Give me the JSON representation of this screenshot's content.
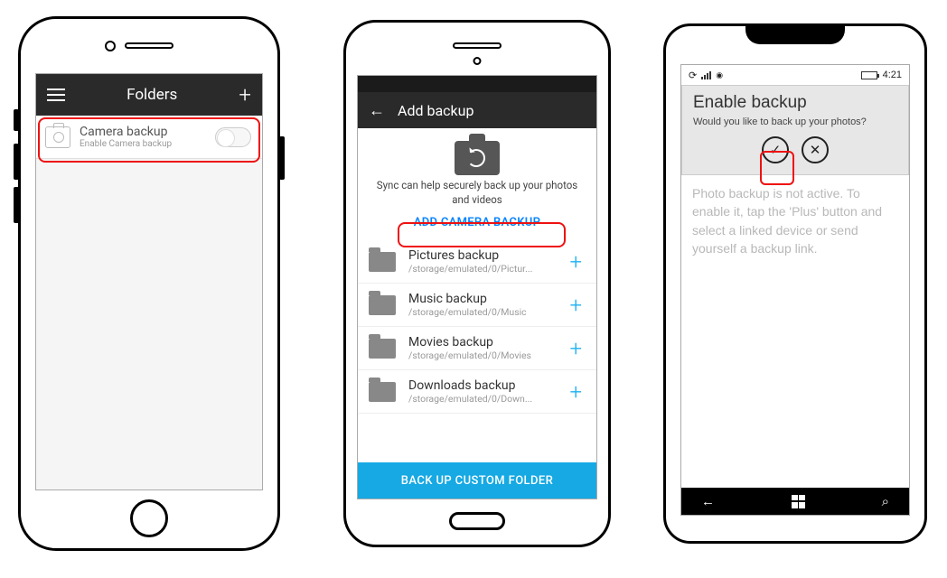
{
  "ios": {
    "header": {
      "title": "Folders"
    },
    "row": {
      "title": "Camera backup",
      "subtitle": "Enable Camera backup"
    }
  },
  "android": {
    "header": {
      "title": "Add backup"
    },
    "hero": {
      "text": "Sync can help securely back up your photos and videos",
      "cta": "ADD CAMERA BACKUP"
    },
    "items": [
      {
        "title": "Pictures backup",
        "path": "/storage/emulated/0/Pictur..."
      },
      {
        "title": "Music backup",
        "path": "/storage/emulated/0/Music"
      },
      {
        "title": "Movies backup",
        "path": "/storage/emulated/0/Movies"
      },
      {
        "title": "Downloads backup",
        "path": "/storage/emulated/0/Down..."
      }
    ],
    "footer": "BACK UP CUSTOM FOLDER"
  },
  "wp": {
    "status": {
      "time": "4:21"
    },
    "dialog": {
      "title": "Enable backup",
      "message": "Would you like to back up your photos?"
    },
    "body": "Photo backup is not active. To enable it, tap the 'Plus' button and select a linked device or send yourself a backup link."
  }
}
